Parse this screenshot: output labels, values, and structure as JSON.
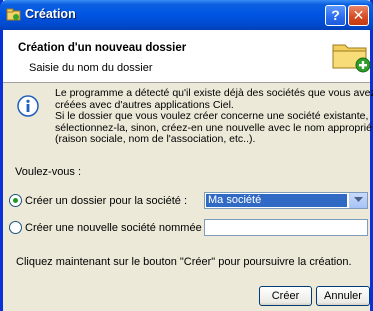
{
  "window": {
    "title": "Création",
    "help_label": "?",
    "close_label": "✕"
  },
  "header": {
    "title": "Création d'un nouveau dossier",
    "subtitle": "Saisie du nom du dossier"
  },
  "info": {
    "lines": [
      "Le programme a détecté qu'il existe déjà des sociétés que vous avez",
      "créées avec d'autres applications Ciel.",
      "Si le dossier que vous voulez créer concerne une société existante,",
      "sélectionnez-la, sinon, créez-en une nouvelle avec le nom approprié",
      "(raison sociale, nom de l'association, etc..)."
    ]
  },
  "form": {
    "question": "Voulez-vous :",
    "option_existing": {
      "label": "Créer un dossier pour la société :",
      "checked": true
    },
    "option_new": {
      "label": "Créer une nouvelle société nommée :",
      "checked": false
    },
    "company_select": {
      "selected": "Ma société"
    },
    "new_company_name": {
      "value": ""
    }
  },
  "hint": "Cliquez maintenant sur le bouton \"Créer\" pour poursuivre la création.",
  "buttons": {
    "create": "Créer",
    "cancel": "Annuler"
  },
  "colors": {
    "title_bar": "#0054e3",
    "dialog_bg": "#ece9d8",
    "selection": "#316ac5"
  },
  "icons": {
    "title": "app-icon",
    "header": "folder-add-icon",
    "info": "info-icon"
  }
}
